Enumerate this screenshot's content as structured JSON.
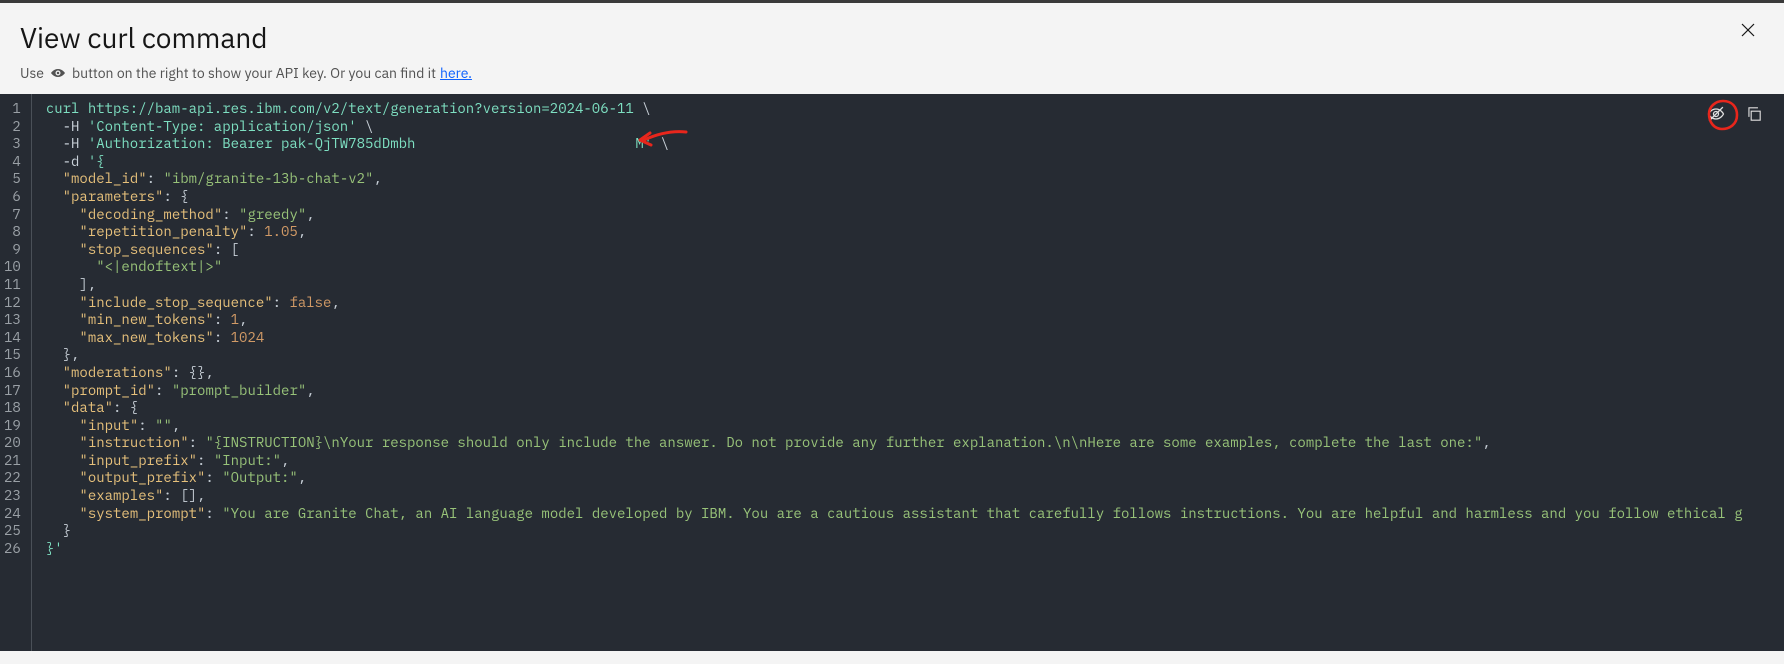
{
  "header": {
    "title": "View curl command",
    "subtitle_prefix": "Use",
    "subtitle_mid": "button on the right to show your API key. Or you can find it",
    "here_label": "here."
  },
  "actions": {
    "close": "close",
    "show_key": "toggle-visibility",
    "copy": "copy"
  },
  "code": {
    "lines": [
      {
        "n": 1,
        "segments": [
          {
            "t": "curl ",
            "c": "tok-cmd"
          },
          {
            "t": "https://bam-api.res.ibm.com/v2/text/generation?version=2024-06-11",
            "c": "tok-url"
          },
          {
            "t": " \\",
            "c": "tok-bs"
          }
        ]
      },
      {
        "n": 2,
        "segments": [
          {
            "t": "  -H ",
            "c": "tok-flag"
          },
          {
            "t": "'Content-Type: application/json'",
            "c": "tok-str"
          },
          {
            "t": " \\",
            "c": "tok-bs"
          }
        ]
      },
      {
        "n": 3,
        "segments": [
          {
            "t": "  -H ",
            "c": "tok-flag"
          },
          {
            "t": "'Authorization: Bearer pak-QjTW785dDmbh",
            "c": "tok-str"
          },
          {
            "gap": true
          },
          {
            "t": "M'",
            "c": "tok-str"
          },
          {
            "t": " \\",
            "c": "tok-bs"
          }
        ]
      },
      {
        "n": 4,
        "segments": [
          {
            "t": "  -d ",
            "c": "tok-flag"
          },
          {
            "t": "'{",
            "c": "tok-str"
          }
        ]
      },
      {
        "n": 5,
        "segments": [
          {
            "t": "  ",
            "c": ""
          },
          {
            "t": "\"model_id\"",
            "c": "tok-key"
          },
          {
            "t": ": ",
            "c": "tok-punc"
          },
          {
            "t": "\"ibm/granite-13b-chat-v2\"",
            "c": "tok-val-str"
          },
          {
            "t": ",",
            "c": "tok-punc"
          }
        ]
      },
      {
        "n": 6,
        "segments": [
          {
            "t": "  ",
            "c": ""
          },
          {
            "t": "\"parameters\"",
            "c": "tok-key"
          },
          {
            "t": ": {",
            "c": "tok-punc"
          }
        ]
      },
      {
        "n": 7,
        "segments": [
          {
            "t": "    ",
            "c": ""
          },
          {
            "t": "\"decoding_method\"",
            "c": "tok-key"
          },
          {
            "t": ": ",
            "c": "tok-punc"
          },
          {
            "t": "\"greedy\"",
            "c": "tok-val-str"
          },
          {
            "t": ",",
            "c": "tok-punc"
          }
        ]
      },
      {
        "n": 8,
        "segments": [
          {
            "t": "    ",
            "c": ""
          },
          {
            "t": "\"repetition_penalty\"",
            "c": "tok-key"
          },
          {
            "t": ": ",
            "c": "tok-punc"
          },
          {
            "t": "1.05",
            "c": "tok-val-num"
          },
          {
            "t": ",",
            "c": "tok-punc"
          }
        ]
      },
      {
        "n": 9,
        "segments": [
          {
            "t": "    ",
            "c": ""
          },
          {
            "t": "\"stop_sequences\"",
            "c": "tok-key"
          },
          {
            "t": ": [",
            "c": "tok-punc"
          }
        ]
      },
      {
        "n": 10,
        "segments": [
          {
            "t": "      ",
            "c": ""
          },
          {
            "t": "\"<|endoftext|>\"",
            "c": "tok-val-str"
          }
        ]
      },
      {
        "n": 11,
        "segments": [
          {
            "t": "    ],",
            "c": "tok-punc"
          }
        ]
      },
      {
        "n": 12,
        "segments": [
          {
            "t": "    ",
            "c": ""
          },
          {
            "t": "\"include_stop_sequence\"",
            "c": "tok-key"
          },
          {
            "t": ": ",
            "c": "tok-punc"
          },
          {
            "t": "false",
            "c": "tok-val-bool"
          },
          {
            "t": ",",
            "c": "tok-punc"
          }
        ]
      },
      {
        "n": 13,
        "segments": [
          {
            "t": "    ",
            "c": ""
          },
          {
            "t": "\"min_new_tokens\"",
            "c": "tok-key"
          },
          {
            "t": ": ",
            "c": "tok-punc"
          },
          {
            "t": "1",
            "c": "tok-val-num"
          },
          {
            "t": ",",
            "c": "tok-punc"
          }
        ]
      },
      {
        "n": 14,
        "segments": [
          {
            "t": "    ",
            "c": ""
          },
          {
            "t": "\"max_new_tokens\"",
            "c": "tok-key"
          },
          {
            "t": ": ",
            "c": "tok-punc"
          },
          {
            "t": "1024",
            "c": "tok-val-num"
          }
        ]
      },
      {
        "n": 15,
        "segments": [
          {
            "t": "  },",
            "c": "tok-punc"
          }
        ]
      },
      {
        "n": 16,
        "segments": [
          {
            "t": "  ",
            "c": ""
          },
          {
            "t": "\"moderations\"",
            "c": "tok-key"
          },
          {
            "t": ": {},",
            "c": "tok-punc"
          }
        ]
      },
      {
        "n": 17,
        "segments": [
          {
            "t": "  ",
            "c": ""
          },
          {
            "t": "\"prompt_id\"",
            "c": "tok-key"
          },
          {
            "t": ": ",
            "c": "tok-punc"
          },
          {
            "t": "\"prompt_builder\"",
            "c": "tok-val-str"
          },
          {
            "t": ",",
            "c": "tok-punc"
          }
        ]
      },
      {
        "n": 18,
        "segments": [
          {
            "t": "  ",
            "c": ""
          },
          {
            "t": "\"data\"",
            "c": "tok-key"
          },
          {
            "t": ": {",
            "c": "tok-punc"
          }
        ]
      },
      {
        "n": 19,
        "segments": [
          {
            "t": "    ",
            "c": ""
          },
          {
            "t": "\"input\"",
            "c": "tok-key"
          },
          {
            "t": ": ",
            "c": "tok-punc"
          },
          {
            "t": "\"\"",
            "c": "tok-val-str"
          },
          {
            "t": ",",
            "c": "tok-punc"
          }
        ]
      },
      {
        "n": 20,
        "segments": [
          {
            "t": "    ",
            "c": ""
          },
          {
            "t": "\"instruction\"",
            "c": "tok-key"
          },
          {
            "t": ": ",
            "c": "tok-punc"
          },
          {
            "t": "\"{INSTRUCTION}\\nYour response should only include the answer. Do not provide any further explanation.\\n\\nHere are some examples, complete the last one:\"",
            "c": "tok-val-str"
          },
          {
            "t": ",",
            "c": "tok-punc"
          }
        ]
      },
      {
        "n": 21,
        "segments": [
          {
            "t": "    ",
            "c": ""
          },
          {
            "t": "\"input_prefix\"",
            "c": "tok-key"
          },
          {
            "t": ": ",
            "c": "tok-punc"
          },
          {
            "t": "\"Input:\"",
            "c": "tok-val-str"
          },
          {
            "t": ",",
            "c": "tok-punc"
          }
        ]
      },
      {
        "n": 22,
        "segments": [
          {
            "t": "    ",
            "c": ""
          },
          {
            "t": "\"output_prefix\"",
            "c": "tok-key"
          },
          {
            "t": ": ",
            "c": "tok-punc"
          },
          {
            "t": "\"Output:\"",
            "c": "tok-val-str"
          },
          {
            "t": ",",
            "c": "tok-punc"
          }
        ]
      },
      {
        "n": 23,
        "segments": [
          {
            "t": "    ",
            "c": ""
          },
          {
            "t": "\"examples\"",
            "c": "tok-key"
          },
          {
            "t": ": [],",
            "c": "tok-punc"
          }
        ]
      },
      {
        "n": 24,
        "segments": [
          {
            "t": "    ",
            "c": ""
          },
          {
            "t": "\"system_prompt\"",
            "c": "tok-key"
          },
          {
            "t": ": ",
            "c": "tok-punc"
          },
          {
            "t": "\"You are Granite Chat, an AI language model developed by IBM. You are a cautious assistant that carefully follows instructions. You are helpful and harmless and you follow ethical g",
            "c": "tok-val-str"
          }
        ]
      },
      {
        "n": 25,
        "segments": [
          {
            "t": "  }",
            "c": "tok-punc"
          }
        ]
      },
      {
        "n": 26,
        "segments": [
          {
            "t": "}'",
            "c": "tok-str"
          }
        ]
      }
    ]
  }
}
